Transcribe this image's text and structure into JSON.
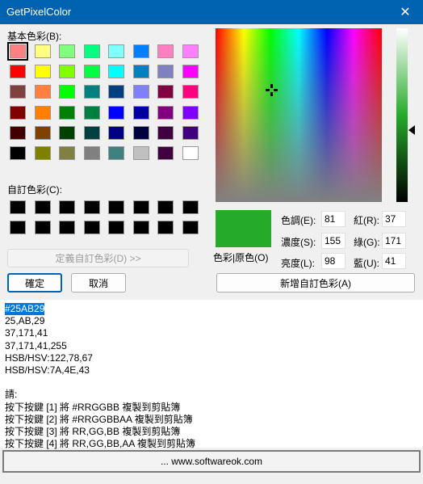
{
  "window": {
    "title": "GetPixelColor",
    "close_glyph": "✕"
  },
  "basic_colors": {
    "label": "基本色彩(B):",
    "rows": [
      [
        "#ff8080",
        "#ffff80",
        "#80ff80",
        "#00ff80",
        "#80ffff",
        "#0080ff",
        "#ff80c0",
        "#ff80ff"
      ],
      [
        "#ff0000",
        "#ffff00",
        "#80ff00",
        "#00ff40",
        "#00ffff",
        "#0080c0",
        "#8080c0",
        "#ff00ff"
      ],
      [
        "#804040",
        "#ff8040",
        "#00ff00",
        "#008080",
        "#004080",
        "#8080ff",
        "#800040",
        "#ff0080"
      ],
      [
        "#800000",
        "#ff8000",
        "#008000",
        "#008040",
        "#0000ff",
        "#0000a0",
        "#800080",
        "#8000ff"
      ],
      [
        "#400000",
        "#804000",
        "#004000",
        "#004040",
        "#000080",
        "#000040",
        "#400040",
        "#400080"
      ],
      [
        "#000000",
        "#808000",
        "#808040",
        "#808080",
        "#408080",
        "#c0c0c0",
        "#400040",
        "#ffffff"
      ]
    ]
  },
  "custom_colors": {
    "label": "自訂色彩(C):",
    "rows": [
      [
        "#000000",
        "#000000",
        "#000000",
        "#000000",
        "#000000",
        "#000000",
        "#000000",
        "#000000"
      ],
      [
        "#000000",
        "#000000",
        "#000000",
        "#000000",
        "#000000",
        "#000000",
        "#000000",
        "#000000"
      ]
    ]
  },
  "buttons": {
    "define_custom": "定義自訂色彩(D) >>",
    "ok": "確定",
    "cancel": "取消",
    "add_custom": "新增自訂色彩(A)"
  },
  "preview": {
    "label": "色彩|原色(O)",
    "color": "#25ab29"
  },
  "fields": {
    "hue_label": "色調(E):",
    "hue": "81",
    "sat_label": "濃度(S):",
    "sat": "155",
    "lum_label": "亮度(L):",
    "lum": "98",
    "red_label": "紅(R):",
    "red": "37",
    "green_label": "綠(G):",
    "green": "171",
    "blue_label": "藍(U):",
    "blue": "41"
  },
  "output": {
    "lines": [
      "#25AB29",
      "25,AB,29",
      "37,171,41",
      "37,171,41,255",
      "HSB/HSV:122,78,67",
      "HSB/HSV:7A,4E,43",
      "",
      "請:",
      "按下按鍵 [1] 將 #RRGGBB 複製到剪貼簿",
      "按下按鍵 [2] 將 #RRGGBBAA 複製到剪貼簿",
      "按下按鍵 [3] 將 RR,GG,BB 複製到剪貼簿",
      "按下按鍵 [4] 將 RR,GG,BB,AA 複製到剪貼簿"
    ]
  },
  "footer": {
    "link": "... www.softwareok.com"
  }
}
